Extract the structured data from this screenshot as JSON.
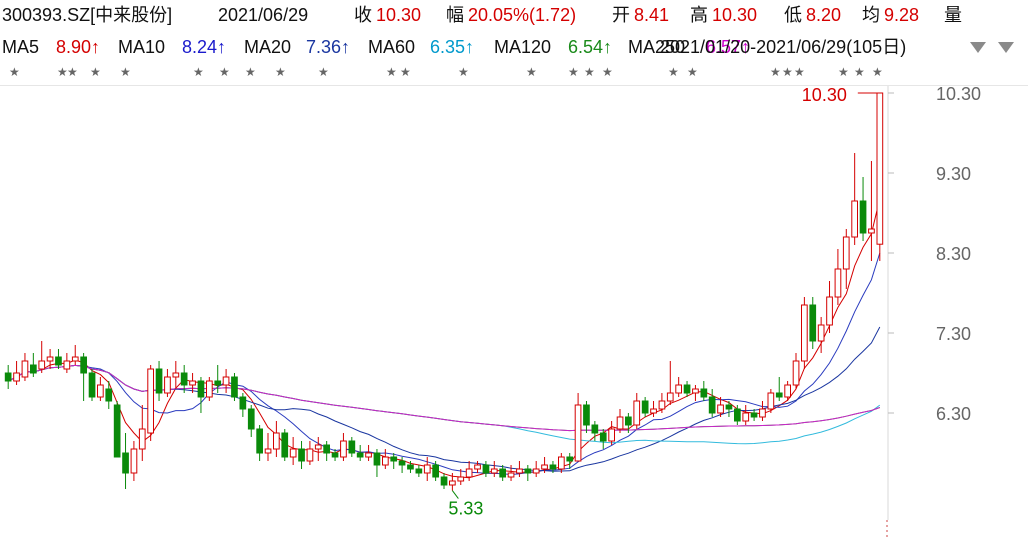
{
  "header": {
    "code": "300393.SZ[中来股份]",
    "date": "2021/06/29",
    "close_label": "收",
    "close_value": "10.30",
    "change_label": "幅",
    "change_value": "20.05%(1.72)",
    "open_label": "开",
    "open_value": "8.41",
    "high_label": "高",
    "high_value": "10.30",
    "low_label": "低",
    "low_value": "8.20",
    "avg_label": "均",
    "avg_value": "9.28",
    "vol_label": "量"
  },
  "ma_bar": {
    "items": [
      {
        "label": "MA5",
        "value": "8.90↑",
        "color": "#d40000"
      },
      {
        "label": "MA10",
        "value": "8.24↑",
        "color": "#0000cc"
      },
      {
        "label": "MA20",
        "value": "7.36↑",
        "color": "#1a36a0"
      },
      {
        "label": "MA60",
        "value": "6.35↑",
        "color": "#0099cc"
      },
      {
        "label": "MA120",
        "value": "6.54↑",
        "color": "#1a8a1a"
      },
      {
        "label": "MA250",
        "value": "6.57↑",
        "color": "#cc00cc"
      }
    ],
    "range": "2021/01/20-2021/06/29(105日)"
  },
  "colors": {
    "up": "#d40000",
    "down": "#0a8a0a",
    "ma5": "#d40000",
    "ma10": "#2a3bbf",
    "ma20": "#1a36a0",
    "ma60": "#33bbdd",
    "ma120": "#2a9a2a",
    "ma250": "#cc22cc"
  },
  "chart_data": {
    "type": "candlestick",
    "title": "300393.SZ[中来股份]",
    "y_ticks": [
      "10.30",
      "9.30",
      "8.30",
      "7.30",
      "6.30"
    ],
    "ylim": [
      5.0,
      10.3
    ],
    "max_label": "10.30",
    "min_label": "5.33",
    "candles": [
      [
        6.8,
        6.7,
        6.9,
        6.6
      ],
      [
        6.7,
        6.8,
        6.95,
        6.65
      ],
      [
        6.75,
        6.95,
        7.05,
        6.7
      ],
      [
        6.9,
        6.8,
        7.05,
        6.75
      ],
      [
        6.85,
        6.95,
        7.2,
        6.8
      ],
      [
        6.95,
        7.0,
        7.1,
        6.85
      ],
      [
        7.0,
        6.9,
        7.1,
        6.85
      ],
      [
        6.85,
        6.95,
        7.05,
        6.8
      ],
      [
        6.95,
        7.0,
        7.15,
        6.9
      ],
      [
        7.0,
        6.8,
        7.05,
        6.45
      ],
      [
        6.8,
        6.5,
        6.85,
        6.45
      ],
      [
        6.5,
        6.65,
        6.75,
        6.45
      ],
      [
        6.6,
        6.45,
        6.7,
        6.35
      ],
      [
        6.4,
        5.75,
        6.45,
        5.75
      ],
      [
        5.8,
        5.55,
        6.05,
        5.35
      ],
      [
        5.55,
        5.85,
        5.95,
        5.45
      ],
      [
        5.85,
        6.1,
        6.4,
        5.7
      ],
      [
        6.05,
        6.85,
        6.9,
        5.95
      ],
      [
        6.85,
        6.55,
        6.95,
        6.45
      ],
      [
        6.55,
        6.75,
        6.85,
        6.5
      ],
      [
        6.75,
        6.8,
        6.95,
        6.6
      ],
      [
        6.8,
        6.65,
        6.9,
        6.55
      ],
      [
        6.65,
        6.7,
        6.8,
        6.55
      ],
      [
        6.7,
        6.5,
        6.75,
        6.3
      ],
      [
        6.5,
        6.7,
        6.75,
        6.45
      ],
      [
        6.7,
        6.65,
        6.9,
        6.55
      ],
      [
        6.65,
        6.75,
        6.85,
        6.55
      ],
      [
        6.75,
        6.5,
        6.8,
        6.45
      ],
      [
        6.5,
        6.35,
        6.55,
        6.25
      ],
      [
        6.35,
        6.1,
        6.4,
        6.0
      ],
      [
        6.1,
        5.8,
        6.15,
        5.7
      ],
      [
        5.8,
        5.85,
        6.05,
        5.7
      ],
      [
        5.85,
        6.05,
        6.2,
        5.75
      ],
      [
        6.05,
        5.75,
        6.1,
        5.7
      ],
      [
        5.75,
        5.85,
        6.0,
        5.65
      ],
      [
        5.85,
        5.7,
        5.95,
        5.6
      ],
      [
        5.7,
        5.85,
        5.95,
        5.65
      ],
      [
        5.85,
        5.9,
        6.0,
        5.7
      ],
      [
        5.9,
        5.8,
        5.95,
        5.7
      ],
      [
        5.8,
        5.75,
        5.85,
        5.7
      ],
      [
        5.75,
        5.95,
        6.05,
        5.7
      ],
      [
        5.95,
        5.8,
        6.0,
        5.75
      ],
      [
        5.8,
        5.75,
        5.9,
        5.7
      ],
      [
        5.75,
        5.8,
        5.9,
        5.7
      ],
      [
        5.8,
        5.65,
        5.85,
        5.5
      ],
      [
        5.65,
        5.75,
        5.85,
        5.6
      ],
      [
        5.75,
        5.7,
        5.8,
        5.6
      ],
      [
        5.7,
        5.65,
        5.75,
        5.55
      ],
      [
        5.65,
        5.6,
        5.7,
        5.55
      ],
      [
        5.6,
        5.55,
        5.65,
        5.5
      ],
      [
        5.55,
        5.65,
        5.75,
        5.45
      ],
      [
        5.65,
        5.5,
        5.7,
        5.45
      ],
      [
        5.5,
        5.4,
        5.55,
        5.35
      ],
      [
        5.4,
        5.45,
        5.55,
        5.33
      ],
      [
        5.45,
        5.5,
        5.6,
        5.4
      ],
      [
        5.5,
        5.6,
        5.7,
        5.45
      ],
      [
        5.6,
        5.65,
        5.7,
        5.55
      ],
      [
        5.65,
        5.55,
        5.7,
        5.5
      ],
      [
        5.55,
        5.6,
        5.7,
        5.5
      ],
      [
        5.6,
        5.5,
        5.65,
        5.45
      ],
      [
        5.5,
        5.55,
        5.65,
        5.45
      ],
      [
        5.55,
        5.6,
        5.7,
        5.5
      ],
      [
        5.6,
        5.55,
        5.65,
        5.45
      ],
      [
        5.55,
        5.6,
        5.7,
        5.5
      ],
      [
        5.6,
        5.65,
        5.75,
        5.55
      ],
      [
        5.65,
        5.6,
        5.7,
        5.55
      ],
      [
        5.6,
        5.75,
        5.8,
        5.55
      ],
      [
        5.75,
        5.7,
        5.8,
        5.6
      ],
      [
        5.7,
        6.4,
        6.55,
        5.7
      ],
      [
        6.4,
        6.15,
        6.45,
        6.05
      ],
      [
        6.15,
        6.05,
        6.2,
        5.95
      ],
      [
        6.05,
        5.95,
        6.1,
        5.85
      ],
      [
        5.95,
        6.1,
        6.2,
        5.9
      ],
      [
        6.1,
        6.25,
        6.35,
        6.05
      ],
      [
        6.25,
        6.15,
        6.3,
        6.05
      ],
      [
        6.15,
        6.45,
        6.55,
        6.1
      ],
      [
        6.45,
        6.3,
        6.5,
        6.25
      ],
      [
        6.3,
        6.35,
        6.45,
        6.25
      ],
      [
        6.35,
        6.45,
        6.55,
        6.3
      ],
      [
        6.45,
        6.55,
        6.95,
        6.4
      ],
      [
        6.55,
        6.65,
        6.75,
        6.5
      ],
      [
        6.65,
        6.55,
        6.7,
        6.5
      ],
      [
        6.55,
        6.6,
        6.65,
        6.45
      ],
      [
        6.6,
        6.5,
        6.7,
        6.45
      ],
      [
        6.5,
        6.3,
        6.6,
        6.25
      ],
      [
        6.3,
        6.4,
        6.5,
        6.25
      ],
      [
        6.4,
        6.35,
        6.45,
        6.25
      ],
      [
        6.35,
        6.2,
        6.4,
        6.15
      ],
      [
        6.2,
        6.3,
        6.4,
        6.15
      ],
      [
        6.3,
        6.25,
        6.35,
        6.2
      ],
      [
        6.25,
        6.35,
        6.45,
        6.2
      ],
      [
        6.35,
        6.55,
        6.6,
        6.3
      ],
      [
        6.55,
        6.5,
        6.75,
        6.45
      ],
      [
        6.5,
        6.65,
        6.7,
        6.45
      ],
      [
        6.65,
        6.95,
        7.05,
        6.6
      ],
      [
        6.95,
        7.65,
        7.75,
        6.85
      ],
      [
        7.65,
        7.2,
        7.75,
        7.1
      ],
      [
        7.2,
        7.4,
        7.5,
        7.05
      ],
      [
        7.4,
        7.75,
        7.95,
        7.3
      ],
      [
        7.75,
        8.1,
        8.35,
        7.65
      ],
      [
        8.1,
        8.5,
        8.6,
        7.85
      ],
      [
        8.5,
        8.95,
        9.55,
        8.4
      ],
      [
        8.95,
        8.55,
        9.25,
        8.45
      ],
      [
        8.55,
        8.6,
        9.45,
        8.2
      ],
      [
        8.41,
        10.3,
        10.3,
        8.2
      ]
    ]
  }
}
